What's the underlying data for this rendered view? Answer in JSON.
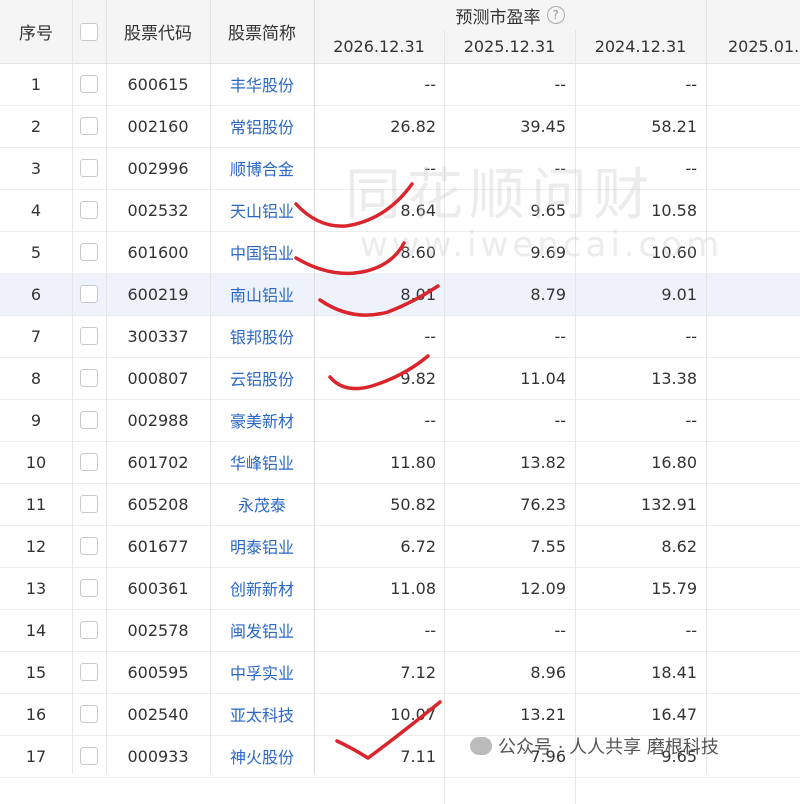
{
  "header": {
    "seq": "序号",
    "code": "股票代码",
    "name": "股票简称",
    "group": "预测市盈率",
    "help": "?",
    "cols": [
      "2026.12.31",
      "2025.12.31",
      "2024.12.31",
      "2025.01."
    ]
  },
  "rows": [
    {
      "n": "1",
      "code": "600615",
      "name": "丰华股份",
      "v1": "--",
      "v2": "--",
      "v3": "--"
    },
    {
      "n": "2",
      "code": "002160",
      "name": "常铝股份",
      "v1": "26.82",
      "v2": "39.45",
      "v3": "58.21"
    },
    {
      "n": "3",
      "code": "002996",
      "name": "顺博合金",
      "v1": "--",
      "v2": "--",
      "v3": "--"
    },
    {
      "n": "4",
      "code": "002532",
      "name": "天山铝业",
      "v1": "8.64",
      "v2": "9.65",
      "v3": "10.58"
    },
    {
      "n": "5",
      "code": "601600",
      "name": "中国铝业",
      "v1": "8.60",
      "v2": "9.69",
      "v3": "10.60"
    },
    {
      "n": "6",
      "code": "600219",
      "name": "南山铝业",
      "v1": "8.01",
      "v2": "8.79",
      "v3": "9.01"
    },
    {
      "n": "7",
      "code": "300337",
      "name": "银邦股份",
      "v1": "--",
      "v2": "--",
      "v3": "--"
    },
    {
      "n": "8",
      "code": "000807",
      "name": "云铝股份",
      "v1": "9.82",
      "v2": "11.04",
      "v3": "13.38"
    },
    {
      "n": "9",
      "code": "002988",
      "name": "豪美新材",
      "v1": "--",
      "v2": "--",
      "v3": "--"
    },
    {
      "n": "10",
      "code": "601702",
      "name": "华峰铝业",
      "v1": "11.80",
      "v2": "13.82",
      "v3": "16.80"
    },
    {
      "n": "11",
      "code": "605208",
      "name": "永茂泰",
      "v1": "50.82",
      "v2": "76.23",
      "v3": "132.91"
    },
    {
      "n": "12",
      "code": "601677",
      "name": "明泰铝业",
      "v1": "6.72",
      "v2": "7.55",
      "v3": "8.62"
    },
    {
      "n": "13",
      "code": "600361",
      "name": "创新新材",
      "v1": "11.08",
      "v2": "12.09",
      "v3": "15.79"
    },
    {
      "n": "14",
      "code": "002578",
      "name": "闽发铝业",
      "v1": "--",
      "v2": "--",
      "v3": "--"
    },
    {
      "n": "15",
      "code": "600595",
      "name": "中孚实业",
      "v1": "7.12",
      "v2": "8.96",
      "v3": "18.41"
    },
    {
      "n": "16",
      "code": "002540",
      "name": "亚太科技",
      "v1": "10.07",
      "v2": "13.21",
      "v3": "16.47"
    },
    {
      "n": "17",
      "code": "000933",
      "name": "神火股份",
      "v1": "7.11",
      "v2": "7.96",
      "v3": "9.65"
    }
  ],
  "watermark": {
    "cn": "同花顺问财",
    "url": "www.iwencai.com"
  },
  "footer": {
    "text": "公众号 · 人人共享 磨根科技"
  },
  "colors": {
    "link": "#2a67c7",
    "header_bg": "#f5f5f5",
    "highlight": "#eef3fb",
    "annotation": "#d9252b"
  }
}
